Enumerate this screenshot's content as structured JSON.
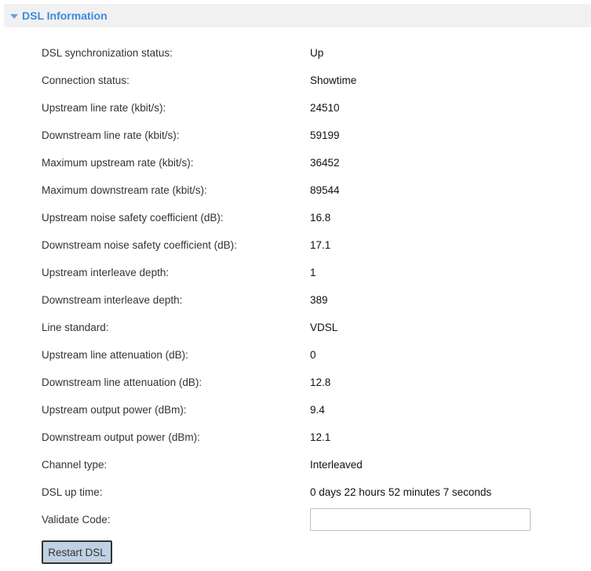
{
  "section": {
    "title": "DSL Information",
    "icon": "triangle-down-icon"
  },
  "info_rows": [
    {
      "label": "DSL synchronization status:",
      "value": "Up"
    },
    {
      "label": "Connection status:",
      "value": "Showtime"
    },
    {
      "label": "Upstream line rate (kbit/s):",
      "value": "24510"
    },
    {
      "label": "Downstream line rate (kbit/s):",
      "value": "59199"
    },
    {
      "label": "Maximum upstream rate (kbit/s):",
      "value": "36452"
    },
    {
      "label": "Maximum downstream rate (kbit/s):",
      "value": "89544"
    },
    {
      "label": "Upstream noise safety coefficient (dB):",
      "value": "16.8"
    },
    {
      "label": "Downstream noise safety coefficient (dB):",
      "value": "17.1"
    },
    {
      "label": "Upstream interleave depth:",
      "value": "1"
    },
    {
      "label": "Downstream interleave depth:",
      "value": "389"
    },
    {
      "label": "Line standard:",
      "value": "VDSL"
    },
    {
      "label": "Upstream line attenuation (dB):",
      "value": "0"
    },
    {
      "label": "Downstream line attenuation (dB):",
      "value": "12.8"
    },
    {
      "label": "Upstream output power (dBm):",
      "value": "9.4"
    },
    {
      "label": "Downstream output power (dBm):",
      "value": "12.1"
    },
    {
      "label": "Channel type:",
      "value": "Interleaved"
    },
    {
      "label": "DSL up time:",
      "value": "0 days 22 hours 52 minutes 7 seconds"
    }
  ],
  "validate": {
    "label": "Validate Code:",
    "value": "",
    "placeholder": ""
  },
  "actions": {
    "restart_label": "Restart DSL"
  },
  "colors": {
    "header_bg": "#f1f1f1",
    "header_title": "#3b8be0",
    "button_bg": "#bfd1e3"
  }
}
